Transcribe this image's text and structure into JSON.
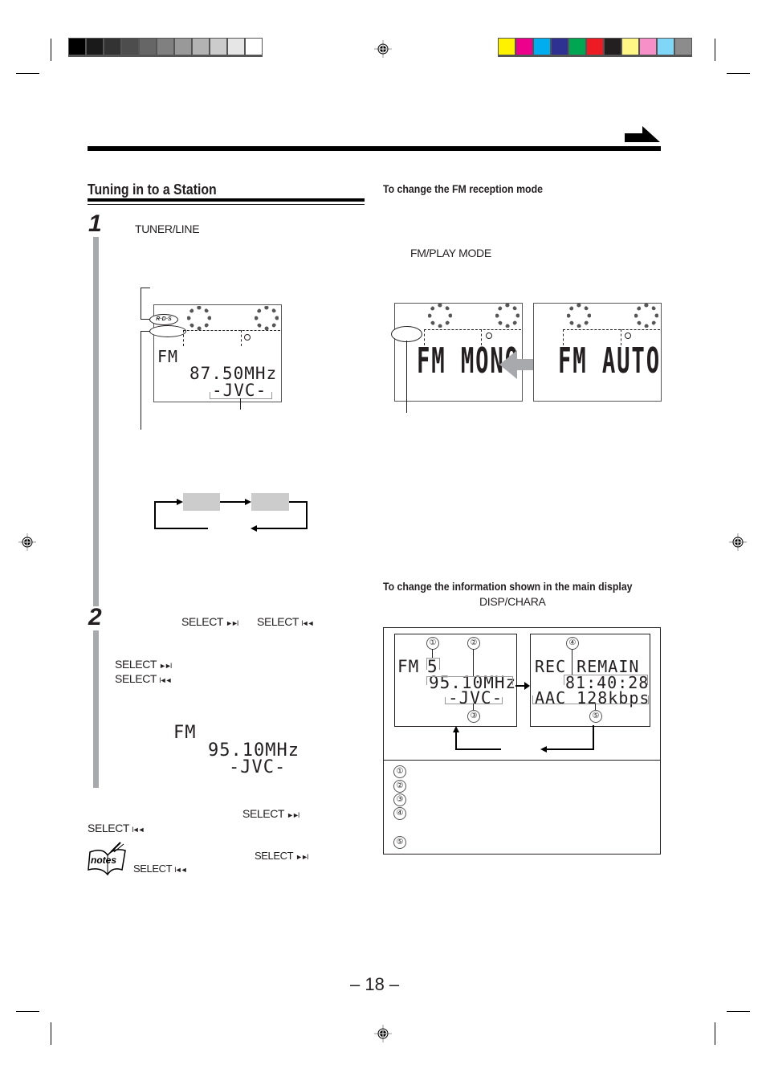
{
  "print_marks": {
    "grayscale_swatches": [
      "#000000",
      "#1a1a1a",
      "#333333",
      "#4d4d4d",
      "#666666",
      "#808080",
      "#999999",
      "#b3b3b3",
      "#cccccc",
      "#e6e6e6",
      "#ffffff"
    ],
    "color_swatches": [
      "#fff200",
      "#ec008c",
      "#00aeef",
      "#2e3192",
      "#00a651",
      "#ed1c24",
      "#231f20",
      "#fff685",
      "#f78fc9",
      "#7fd6f7",
      "#8c8c8c"
    ]
  },
  "header": {
    "continue_arrow_icon": "arrow-right-icon"
  },
  "left": {
    "section_title": "Tuning in to a Station",
    "step1": {
      "number": "1",
      "button": "TUNER/LINE",
      "display": {
        "rds_label": "R·D·S",
        "band": "FM",
        "frequency": "87.50MHz",
        "station": "-JVC-"
      }
    },
    "step2": {
      "number": "2",
      "select_next": "SELECT",
      "select_prev": "SELECT",
      "display": {
        "band": "FM",
        "frequency": "95.10MHz",
        "station": "-JVC-"
      }
    },
    "footer_select_next": "SELECT",
    "footer_select_prev": "SELECT",
    "notes": {
      "icon_label": "notes",
      "select_next": "SELECT",
      "select_prev": "SELECT"
    }
  },
  "right": {
    "fm_mode": {
      "title": "To change the FM reception mode",
      "button": "FM/PLAY MODE",
      "display_mono": "FM MONO",
      "display_auto": "FM AUTO"
    },
    "main_display": {
      "title": "To change the information shown in the main display",
      "button": "DISP/CHARA",
      "display_a": {
        "band": "FM",
        "preset": "5",
        "frequency": "95.10MHz",
        "station": "-JVC-"
      },
      "display_b": {
        "line1": "REC REMAIN",
        "time": "81:40:28",
        "format": "AAC 128kbps"
      },
      "callouts": [
        "①",
        "②",
        "③",
        "④",
        "⑤"
      ]
    }
  },
  "page_number": "– 18 –"
}
